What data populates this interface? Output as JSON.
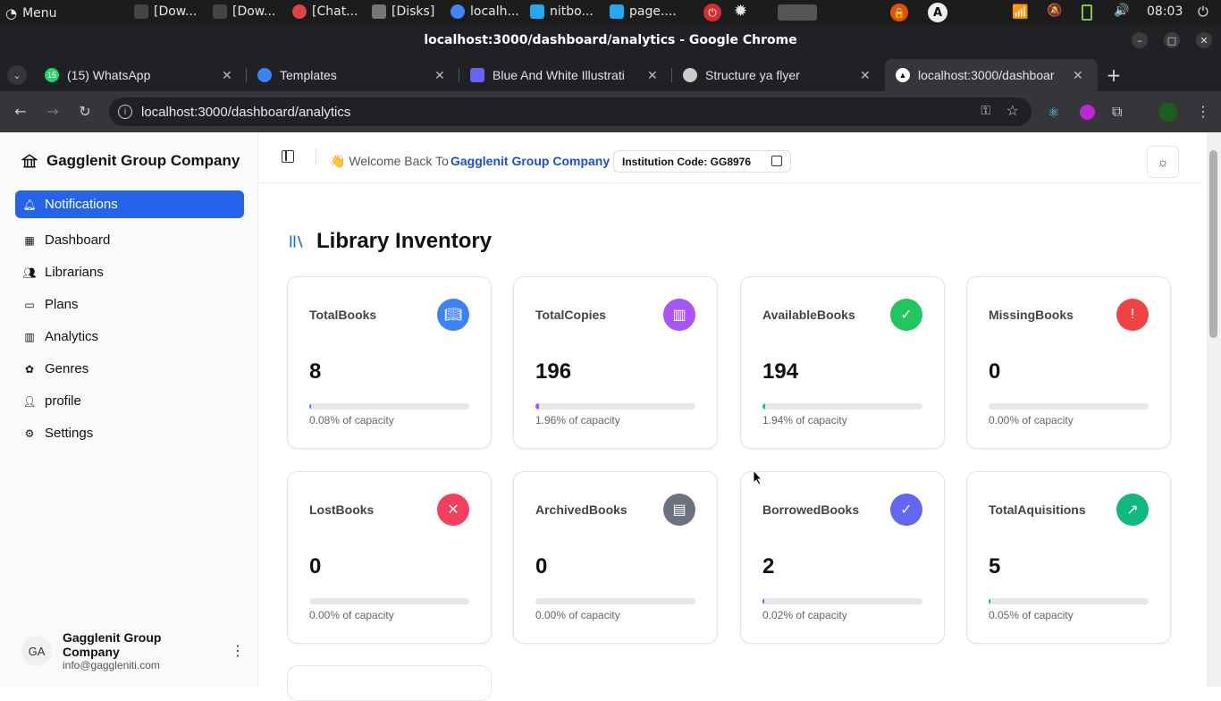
{
  "os": {
    "menu_label": "Menu",
    "taskbar": [
      "[Dow...",
      "[Dow...",
      "[Chat...",
      "[Disks]",
      "localh...",
      "nitbo...",
      "page...."
    ],
    "clock": "08:03"
  },
  "window": {
    "title": "localhost:3000/dashboard/analytics - Google Chrome"
  },
  "tabs": [
    {
      "label": "(15) WhatsApp",
      "badge": "15",
      "color": "#25d366"
    },
    {
      "label": "Templates",
      "color": "#3b82f6"
    },
    {
      "label": "Blue And White Illustrati",
      "color": "#6366f1"
    },
    {
      "label": "Structure ya flyer",
      "color": "#cccccc"
    },
    {
      "label": "localhost:3000/dashboar",
      "color": "#ffffff"
    }
  ],
  "address": {
    "url": "localhost:3000/dashboard/analytics"
  },
  "sidebar": {
    "brand": "Gagglenit Group Company",
    "items": [
      {
        "label": "Notifications",
        "icon": "bell-icon",
        "active": true
      },
      {
        "label": "Dashboard",
        "icon": "grid-icon"
      },
      {
        "label": "Librarians",
        "icon": "users-icon"
      },
      {
        "label": "Plans",
        "icon": "card-icon"
      },
      {
        "label": "Analytics",
        "icon": "bar-chart-icon"
      },
      {
        "label": "Genres",
        "icon": "flower-icon"
      },
      {
        "label": "profile",
        "icon": "user-icon"
      },
      {
        "label": "Settings",
        "icon": "gear-icon"
      }
    ],
    "user": {
      "initials": "GA",
      "name": "Gagglenit Group Company",
      "email": "info@gaggleniti.com"
    }
  },
  "header": {
    "welcome_prefix": "👋 Welcome Back To",
    "company": "Gagglenit Group Company",
    "institution_code": "Institution Code: GG8976"
  },
  "page": {
    "title": "Library Inventory"
  },
  "cards": [
    {
      "label": "TotalBooks",
      "value": "8",
      "caption": "0.08% of capacity",
      "percent": 0.08,
      "color": "#3b82f6",
      "icon": "book-open-icon"
    },
    {
      "label": "TotalCopies",
      "value": "196",
      "caption": "1.96% of capacity",
      "percent": 1.96,
      "color": "#a855f7",
      "icon": "library-icon"
    },
    {
      "label": "AvailableBooks",
      "value": "194",
      "caption": "1.94% of capacity",
      "percent": 1.94,
      "color": "#22c55e",
      "icon": "check-circle-icon"
    },
    {
      "label": "MissingBooks",
      "value": "0",
      "caption": "0.00% of capacity",
      "percent": 0,
      "color": "#ef4444",
      "icon": "alert-circle-icon"
    },
    {
      "label": "LostBooks",
      "value": "0",
      "caption": "0.00% of capacity",
      "percent": 0,
      "color": "#f43f5e",
      "icon": "book-x-icon"
    },
    {
      "label": "ArchivedBooks",
      "value": "0",
      "caption": "0.00% of capacity",
      "percent": 0,
      "color": "#6b7280",
      "icon": "archive-icon"
    },
    {
      "label": "BorrowedBooks",
      "value": "2",
      "caption": "0.02% of capacity",
      "percent": 0.02,
      "color": "#6366f1",
      "icon": "book-check-icon"
    },
    {
      "label": "TotalAquisitions",
      "value": "5",
      "caption": "0.05% of capacity",
      "percent": 0.05,
      "color": "#10b981",
      "icon": "trending-up-icon"
    }
  ]
}
